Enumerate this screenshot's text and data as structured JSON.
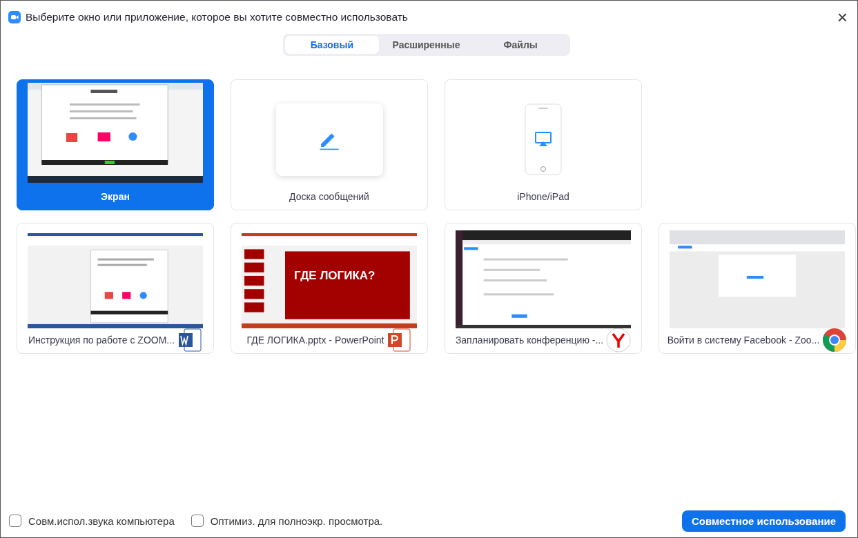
{
  "window": {
    "title": "Выберите окно или приложение, которое вы хотите совместно использовать",
    "close": "×"
  },
  "tabs": [
    {
      "label": "Базовый",
      "selected": true
    },
    {
      "label": "Расширенные",
      "selected": false
    },
    {
      "label": "Файлы",
      "selected": false
    }
  ],
  "tiles": [
    {
      "kind": "screen",
      "label": "Экран",
      "selected": true
    },
    {
      "kind": "whiteboard",
      "label": "Доска сообщений",
      "selected": false
    },
    {
      "kind": "device",
      "label": "iPhone/iPad",
      "selected": false
    },
    {
      "kind": "word",
      "label": "Инструкция по работе с ZOOM...",
      "selected": false
    },
    {
      "kind": "powerpoint",
      "label": "ГДЕ ЛОГИКА.pptx - PowerPoint",
      "slide_title": "ГДЕ ЛОГИКА?",
      "selected": false
    },
    {
      "kind": "yandex",
      "label": "Запланировать конференцию -...",
      "selected": false
    },
    {
      "kind": "chrome",
      "label": "Войти в систему Facebook - Zoo...",
      "selected": false
    }
  ],
  "options": [
    {
      "label": "Совм.испол.звука компьютера",
      "checked": false
    },
    {
      "label": "Оптимиз. для полноэкр. просмотра.",
      "checked": false
    }
  ],
  "share_button": "Совместное использование"
}
